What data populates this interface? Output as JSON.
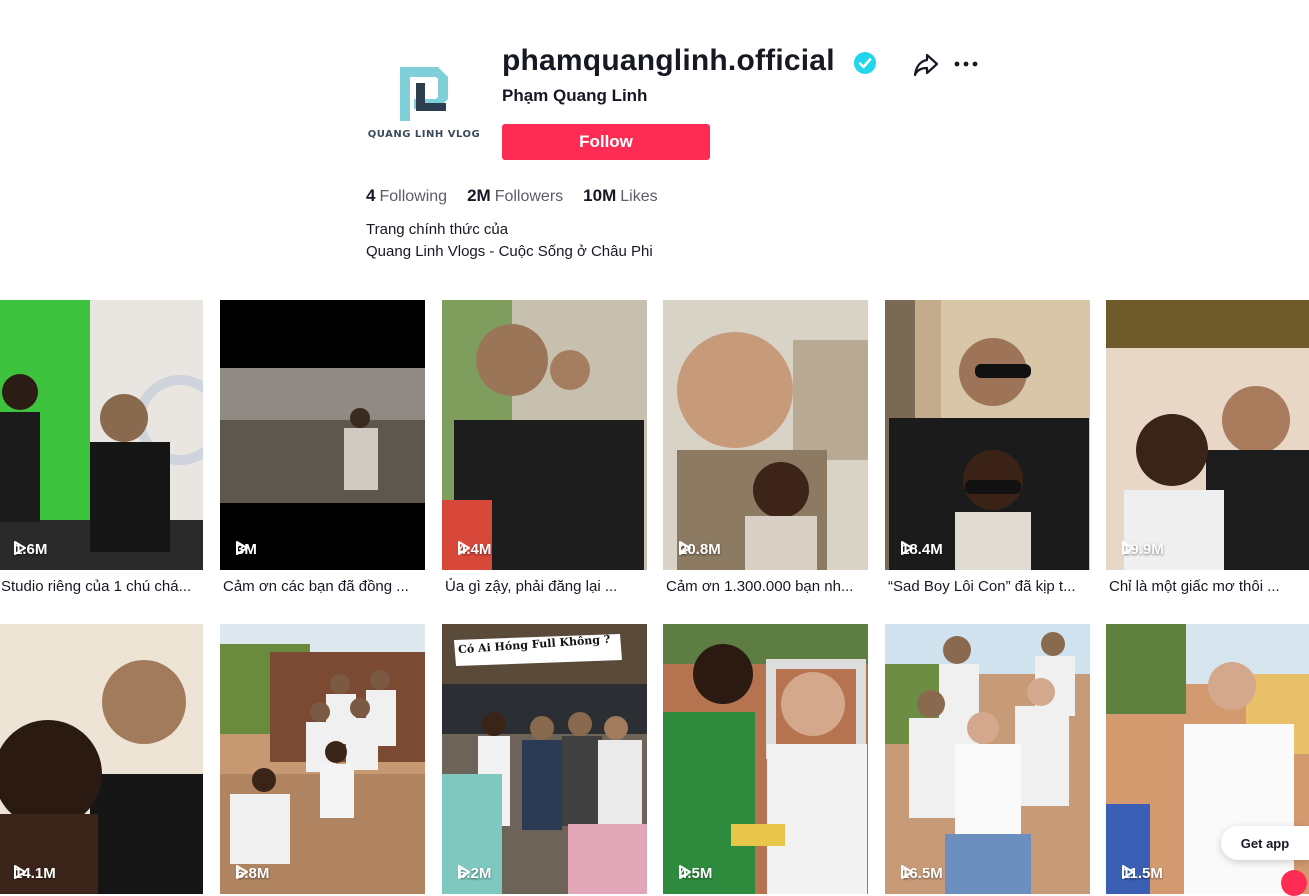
{
  "profile": {
    "username": "phamquanglinh.official",
    "nickname": "Phạm Quang Linh",
    "avatar_text": "QUANG LINH VLOG",
    "follow_label": "Follow",
    "stats": {
      "following_count": "4",
      "following_label": "Following",
      "followers_count": "2M",
      "followers_label": "Followers",
      "likes_count": "10M",
      "likes_label": "Likes"
    },
    "bio_line1": "Trang chính thức của",
    "bio_line2": "Quang Linh Vlogs - Cuộc Sống ở Châu Phi"
  },
  "videos": [
    {
      "views": "1.6M",
      "caption": "Studio riêng của 1 chú chá..."
    },
    {
      "views": "3M",
      "caption": "Cảm ơn các bạn đã đồng ..."
    },
    {
      "views": "4.4M",
      "caption": "Ủa gì zậy, phải đăng lại ..."
    },
    {
      "views": "20.8M",
      "caption": "Cảm ơn 1.300.000 bạn nh..."
    },
    {
      "views": "18.4M",
      "caption": "“Sad Boy Lôi Con” đã kịp t..."
    },
    {
      "views": "19.9M",
      "caption": "Chỉ là một giấc mơ thôi ..."
    },
    {
      "views": "14.1M",
      "caption": ""
    },
    {
      "views": "6.8M",
      "caption": ""
    },
    {
      "views": "6.2M",
      "caption": "",
      "overlay_text": "Có Ai Hóng Full Không ?"
    },
    {
      "views": "4.5M",
      "caption": ""
    },
    {
      "views": "16.5M",
      "caption": ""
    },
    {
      "views": "11.5M",
      "caption": ""
    }
  ],
  "get_app_label": "Get app",
  "colors": {
    "accent": "#fe2c55",
    "verified": "#20d5ec"
  }
}
